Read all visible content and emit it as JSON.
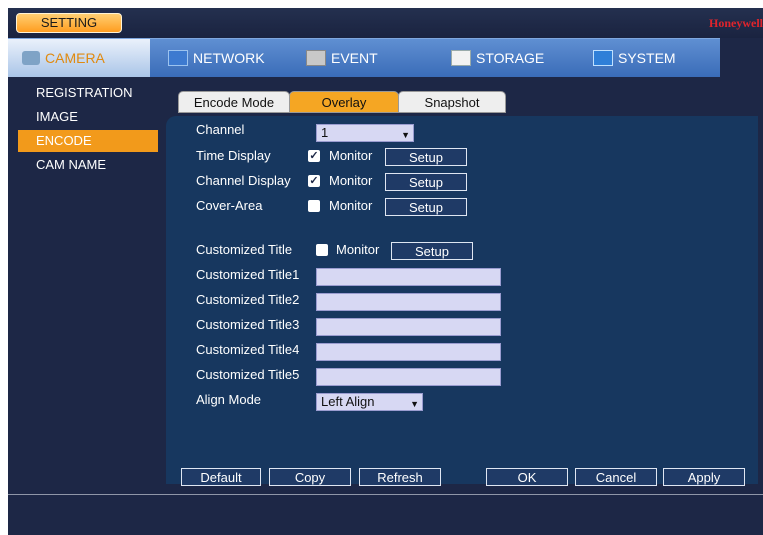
{
  "header": {
    "setting_label": "SETTING",
    "brand": "Honeywell"
  },
  "menu": [
    {
      "label": "CAMERA",
      "icon": "camera-icon"
    },
    {
      "label": "NETWORK",
      "icon": "network-icon"
    },
    {
      "label": "EVENT",
      "icon": "event-icon"
    },
    {
      "label": "STORAGE",
      "icon": "storage-icon"
    },
    {
      "label": "SYSTEM",
      "icon": "system-icon"
    }
  ],
  "sidebar": [
    "REGISTRATION",
    "IMAGE",
    "ENCODE",
    "CAM NAME"
  ],
  "subtabs": [
    "Encode Mode",
    "Overlay",
    "Snapshot"
  ],
  "form": {
    "channel_label": "Channel",
    "channel_value": "1",
    "time_display": {
      "label": "Time Display",
      "monitor": "Monitor",
      "checked": true,
      "setup": "Setup"
    },
    "channel_display": {
      "label": "Channel Display",
      "monitor": "Monitor",
      "checked": true,
      "setup": "Setup"
    },
    "cover_area": {
      "label": "Cover-Area",
      "monitor": "Monitor",
      "checked": false,
      "setup": "Setup"
    },
    "customized_title": {
      "label": "Customized Title",
      "monitor": "Monitor",
      "checked": false,
      "setup": "Setup"
    },
    "titles": [
      "Customized Title1",
      "Customized Title2",
      "Customized Title3",
      "Customized Title4",
      "Customized Title5"
    ],
    "align_label": "Align Mode",
    "align_value": "Left Align"
  },
  "footer_buttons": [
    "Default",
    "Copy",
    "Refresh",
    "OK",
    "Cancel",
    "Apply"
  ],
  "colors": {
    "accent": "#f29a1b",
    "menu_blue": "#4a7cc4",
    "panel": "#17375f",
    "background": "#1d2746"
  }
}
